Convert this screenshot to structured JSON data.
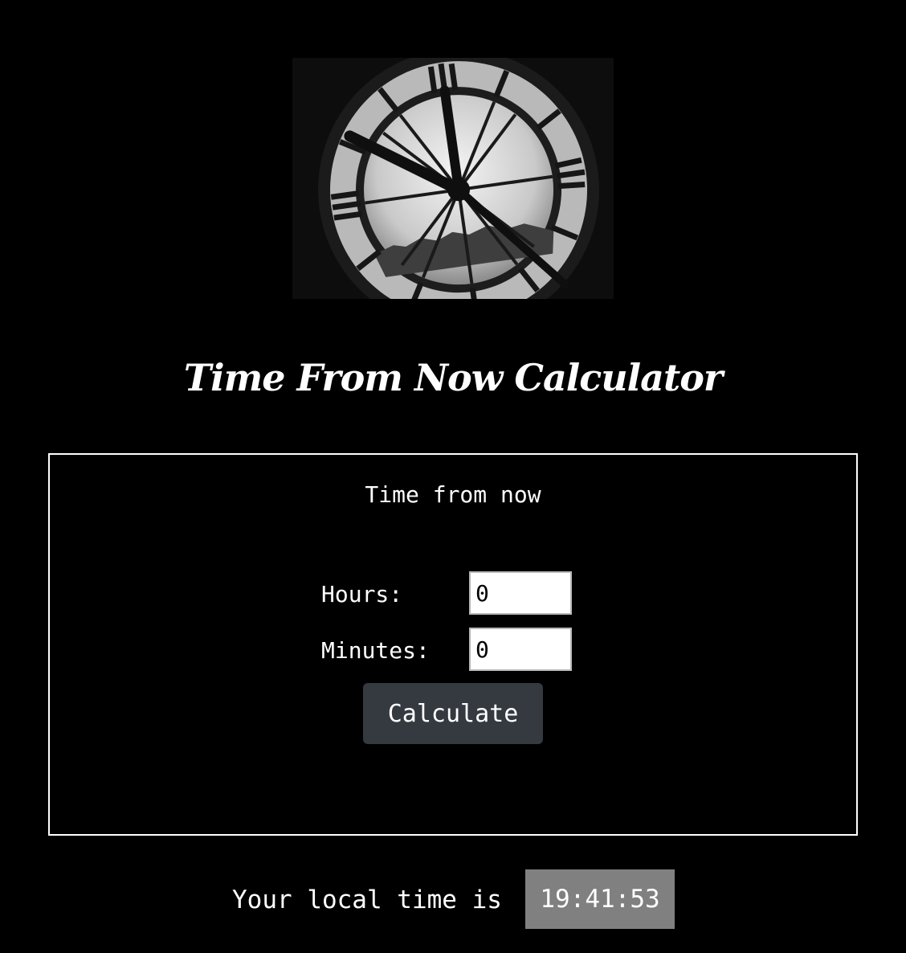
{
  "page": {
    "title": "Time From Now Calculator"
  },
  "hero_image": {
    "icon": "clock-face-image"
  },
  "calculator": {
    "heading": "Time from now",
    "hours_label": "Hours:",
    "hours_value": "0",
    "minutes_label": "Minutes:",
    "minutes_value": "0",
    "button_label": "Calculate"
  },
  "local_time": {
    "label": "Your local time is",
    "value": "19:41:53"
  },
  "colors": {
    "background": "#000000",
    "text": "#ffffff",
    "button_bg": "#343a40",
    "time_badge_bg": "#808080"
  }
}
